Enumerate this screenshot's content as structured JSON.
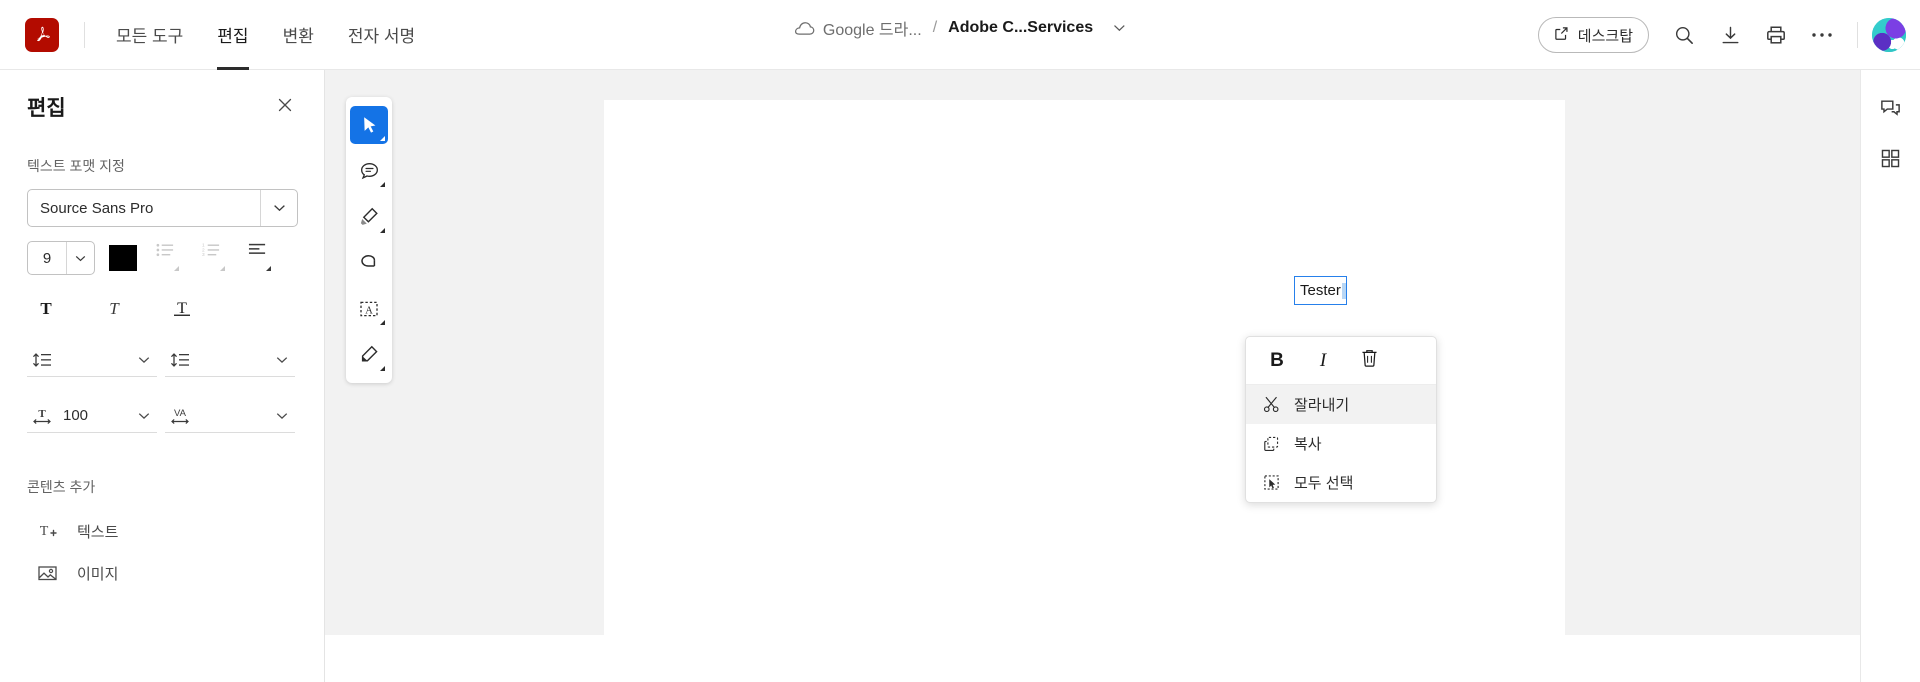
{
  "header": {
    "logo_icon": "acrobat-logo-icon",
    "tabs": [
      {
        "label": "모든 도구",
        "active": false
      },
      {
        "label": "편집",
        "active": true
      },
      {
        "label": "변환",
        "active": false
      },
      {
        "label": "전자 서명",
        "active": false
      }
    ],
    "breadcrumb": {
      "cloud_icon": "cloud-icon",
      "source": "Google 드라...",
      "separator": "/",
      "title": "Adobe C...Services",
      "chevron_icon": "chevron-down-icon"
    },
    "right": {
      "desktop_button": {
        "label": "데스크탑",
        "icon": "external-link-icon"
      },
      "icons": [
        {
          "name": "search-icon"
        },
        {
          "name": "download-icon"
        },
        {
          "name": "print-icon"
        },
        {
          "name": "more-options-icon"
        }
      ],
      "avatar": "user-avatar"
    }
  },
  "left_panel": {
    "title": "편집",
    "close_icon": "close-icon",
    "text_format_section": {
      "label": "텍스트 포맷 지정",
      "font_family": {
        "value": "Source Sans Pro",
        "arrow_icon": "chevron-down-icon"
      },
      "font_size": {
        "value": "9",
        "arrow_icon": "chevron-down-icon"
      },
      "font_color": "#000000",
      "list_buttons": [
        {
          "name": "bullet-list-icon",
          "enabled": false
        },
        {
          "name": "numbered-list-icon",
          "enabled": false
        },
        {
          "name": "text-align-icon",
          "enabled": true
        }
      ],
      "style_buttons": [
        {
          "name": "bold-icon",
          "label": "T"
        },
        {
          "name": "italic-icon",
          "label": "T"
        },
        {
          "name": "underline-icon",
          "label": "T"
        }
      ],
      "line_spacing": {
        "icon": "line-spacing-icon",
        "value": "",
        "arrow_icon": "chevron-down-icon"
      },
      "paragraph_spacing": {
        "icon": "paragraph-spacing-icon",
        "value": "",
        "arrow_icon": "chevron-down-icon"
      },
      "horizontal_scale": {
        "icon": "horizontal-scale-icon",
        "value": "100",
        "arrow_icon": "chevron-down-icon"
      },
      "tracking": {
        "icon": "tracking-icon",
        "label": "VA",
        "value": "",
        "arrow_icon": "chevron-down-icon"
      }
    },
    "add_content_section": {
      "label": "콘텐츠 추가",
      "items": [
        {
          "label": "텍스트",
          "icon": "add-text-icon"
        },
        {
          "label": "이미지",
          "icon": "add-image-icon"
        }
      ]
    }
  },
  "toolbar": {
    "tools": [
      {
        "name": "select-tool-icon",
        "active": true
      },
      {
        "name": "comment-tool-icon",
        "active": false
      },
      {
        "name": "highlight-tool-icon",
        "active": false
      },
      {
        "name": "eraser-tool-icon",
        "active": false
      },
      {
        "name": "text-box-tool-icon",
        "active": false
      },
      {
        "name": "draw-signature-tool-icon",
        "active": false
      }
    ]
  },
  "document": {
    "textbox_value": "Tester"
  },
  "context_menu": {
    "tools": [
      {
        "name": "bold-button",
        "label": "B"
      },
      {
        "name": "italic-button",
        "label": "I"
      },
      {
        "name": "delete-button",
        "label": "",
        "icon": "trash-icon"
      }
    ],
    "items": [
      {
        "label": "잘라내기",
        "icon": "cut-icon",
        "hover": true
      },
      {
        "label": "복사",
        "icon": "copy-icon",
        "hover": false
      },
      {
        "label": "모두 선택",
        "icon": "select-all-icon",
        "hover": false
      }
    ]
  },
  "right_rail": {
    "buttons": [
      {
        "name": "comments-panel-icon"
      },
      {
        "name": "all-tools-grid-icon"
      }
    ]
  },
  "colors": {
    "accent_blue": "#1473e6",
    "selection_blue": "#2680eb",
    "acrobat_red": "#b30b00",
    "canvas_gray": "#f2f2f2"
  }
}
